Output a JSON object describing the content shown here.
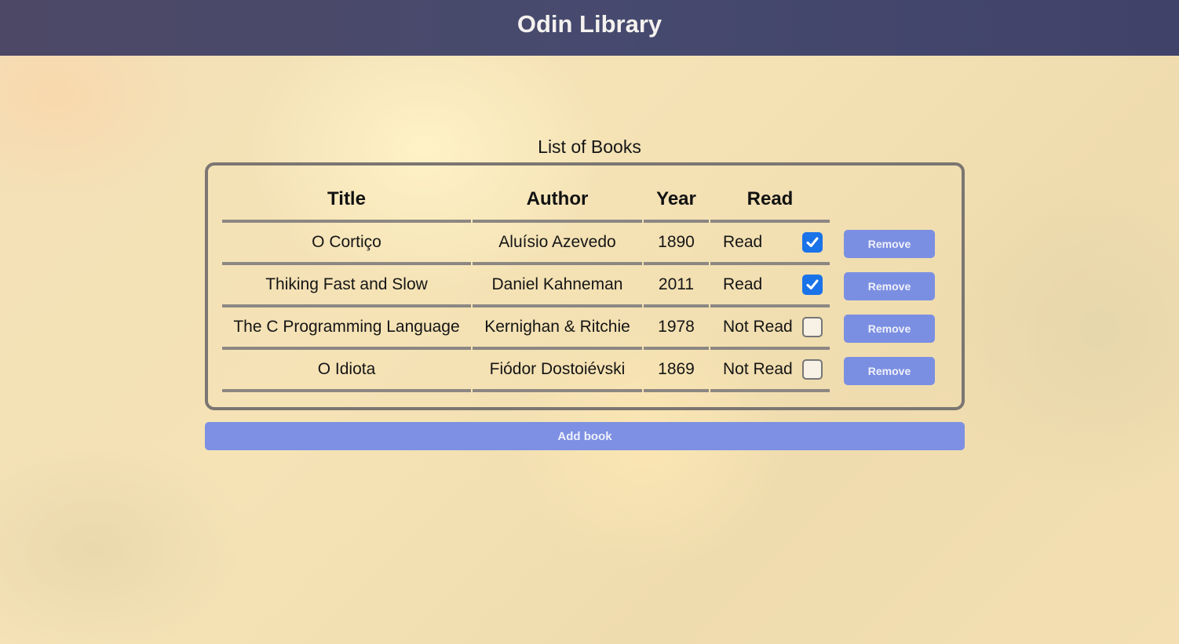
{
  "header": {
    "title": "Odin Library"
  },
  "library": {
    "caption": "List of Books",
    "columns": [
      "Title",
      "Author",
      "Year",
      "Read"
    ],
    "books": [
      {
        "title": "O Cortiço",
        "author": "Aluísio Azevedo",
        "year": "1890",
        "status": "Read",
        "checked": true,
        "remove_label": "Remove"
      },
      {
        "title": "Thiking Fast and Slow",
        "author": "Daniel Kahneman",
        "year": "2011",
        "status": "Read",
        "checked": true,
        "remove_label": "Remove"
      },
      {
        "title": "The C Programming Language",
        "author": "Kernighan & Ritchie",
        "year": "1978",
        "status": "Not Read",
        "checked": false,
        "remove_label": "Remove"
      },
      {
        "title": "O Idiota",
        "author": "Fiódor Dostoiévski",
        "year": "1869",
        "status": "Not Read",
        "checked": false,
        "remove_label": "Remove"
      }
    ],
    "add_label": "Add book"
  },
  "colors": {
    "header_bg": "#474a6e",
    "button": "#7b8fe2",
    "checkbox_checked": "#1a73e8"
  }
}
